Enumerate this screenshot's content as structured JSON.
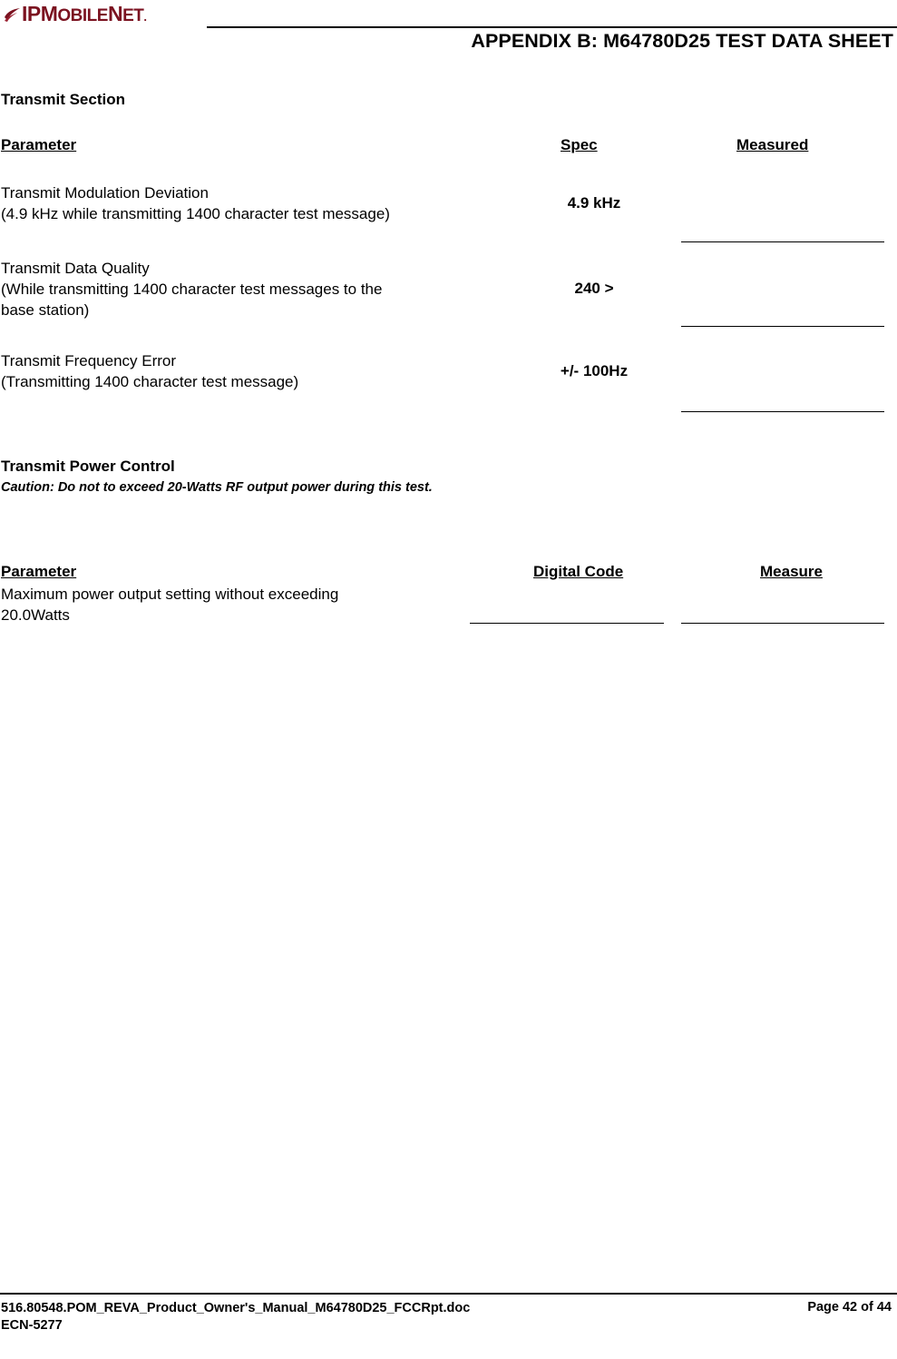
{
  "header": {
    "logo": {
      "icon": "ipmobilenet-swoosh-icon",
      "text_ip": "IP",
      "text_m": "M",
      "text_obile": "OBILE",
      "text_n": "N",
      "text_et": "ET",
      "text_dot": ".",
      "brand_color": "#7b1220"
    },
    "title": "APPENDIX B:  M64780D25 TEST DATA SHEET"
  },
  "transmit_section": {
    "heading": "Transmit Section",
    "columns": {
      "parameter": "Parameter",
      "spec": "Spec",
      "measured": "Measured"
    },
    "rows": [
      {
        "parameter": "Transmit Modulation Deviation\n(4.9 kHz while transmitting 1400 character test message)",
        "spec": "4.9 kHz",
        "measured": ""
      },
      {
        "parameter": "Transmit Data Quality\n(While transmitting 1400 character test messages to the\nbase station)",
        "spec": "240 >",
        "measured": ""
      },
      {
        "parameter": "Transmit Frequency Error\n(Transmitting 1400 character test message)",
        "spec": "+/- 100Hz",
        "measured": ""
      }
    ]
  },
  "power_control_section": {
    "heading": "Transmit Power Control",
    "caution": "Caution: Do not to exceed 20-Watts RF output power during this test.",
    "columns": {
      "parameter": "Parameter",
      "digital_code": "Digital Code",
      "measure": "Measure"
    },
    "rows": [
      {
        "parameter": "Maximum power output setting without exceeding\n20.0Watts",
        "digital_code": "",
        "measure": ""
      }
    ]
  },
  "footer": {
    "left": "516.80548.POM_REVA_Product_Owner's_Manual_M64780D25_FCCRpt.doc\nECN-5277",
    "right": "Page 42 of 44"
  }
}
